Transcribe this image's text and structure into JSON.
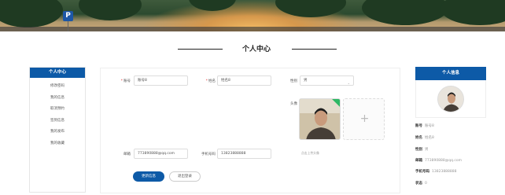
{
  "banner": {
    "parking_sign": "P"
  },
  "page_title": "个人中心",
  "left_menu": {
    "header": "个人中心",
    "items": [
      "修改密码",
      "我的信息",
      "取消预约",
      "签到信息",
      "我的发布",
      "我的收藏"
    ]
  },
  "form": {
    "account_label": "账号",
    "account_value": "账号8",
    "name_label": "姓名",
    "name_value": "姓名8",
    "gender_label": "性别",
    "gender_value": "男",
    "avatar_label": "头像",
    "upload_hint": "点击上传头像",
    "email_label": "邮箱",
    "email_value": "773890888@qq.com",
    "phone_label": "手机号码",
    "phone_value": "13823888888",
    "update_button": "更新信息",
    "logout_button": "退出登录"
  },
  "profile_card": {
    "header": "个人信息",
    "rows": [
      {
        "key": "账号",
        "value": "账号8"
      },
      {
        "key": "姓名",
        "value": "姓名8"
      },
      {
        "key": "性别",
        "value": "男"
      },
      {
        "key": "邮箱",
        "value": "773890888@qq.com"
      },
      {
        "key": "手机号码",
        "value": "13823888888"
      },
      {
        "key": "状态",
        "value": "0"
      }
    ]
  },
  "colors": {
    "primary": "#0d5aa7",
    "required": "#ee3333",
    "avatar_badge": "#2db764"
  }
}
